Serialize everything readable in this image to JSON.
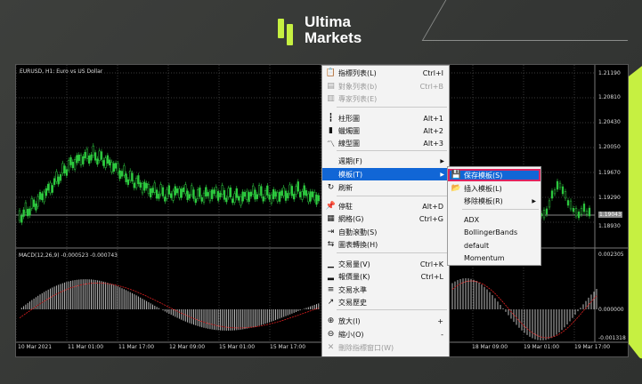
{
  "brand": {
    "line1": "Ultima",
    "line2": "Markets",
    "accent": "#c6f041"
  },
  "chart": {
    "symbol_label": "EURUSD, H1:  Euro vs US Dollar",
    "macd_label": "MACD(12,26,9) -0.000523 -0.000743",
    "y_ticks_main": [
      "1.21190",
      "1.20810",
      "1.20430",
      "1.20050",
      "1.19670",
      "1.19290",
      "1.18930"
    ],
    "current_price": "1.19043",
    "y_ticks_macd": [
      "0.002305",
      "0.000000",
      "-0.001318"
    ],
    "x_ticks": [
      "10 Mar 2021",
      "11 Mar 01:00",
      "11 Mar 17:00",
      "12 Mar 09:00",
      "15 Mar 01:00",
      "15 Mar 17:00",
      "",
      "",
      "",
      "18 Mar 09:00",
      "19 Mar 01:00",
      "19 Mar 17:00"
    ]
  },
  "context_menu": {
    "items": [
      {
        "label": "指標列表(L)",
        "shortcut": "Ctrl+I",
        "icon": "indicator-list-icon",
        "glyph": "📋",
        "disabled": false
      },
      {
        "label": "對象列表(b)",
        "shortcut": "Ctrl+B",
        "icon": "object-list-icon",
        "glyph": "▤",
        "disabled": true
      },
      {
        "label": "專家列表(E)",
        "shortcut": "",
        "icon": "expert-list-icon",
        "glyph": "▥",
        "disabled": true
      },
      {
        "label": "柱形圖",
        "shortcut": "Alt+1",
        "icon": "bar-chart-icon",
        "glyph": "┇",
        "disabled": false
      },
      {
        "label": "蠟燭圖",
        "shortcut": "Alt+2",
        "icon": "candlestick-icon",
        "glyph": "▮",
        "disabled": false
      },
      {
        "label": "線型圖",
        "shortcut": "Alt+3",
        "icon": "line-chart-icon",
        "glyph": "〽",
        "disabled": false
      },
      {
        "label": "週期(F)",
        "shortcut": "",
        "icon": "",
        "glyph": "",
        "disabled": false,
        "submenu": true
      },
      {
        "label": "模板(T)",
        "shortcut": "",
        "icon": "",
        "glyph": "",
        "disabled": false,
        "submenu": true,
        "selected": true
      },
      {
        "label": "刷新",
        "shortcut": "",
        "icon": "refresh-icon",
        "glyph": "↻",
        "disabled": false
      },
      {
        "label": "停駐",
        "shortcut": "Alt+D",
        "icon": "pin-icon",
        "glyph": "📌",
        "disabled": false
      },
      {
        "label": "網格(G)",
        "shortcut": "Ctrl+G",
        "icon": "grid-icon",
        "glyph": "▦",
        "disabled": false
      },
      {
        "label": "自動滾動(S)",
        "shortcut": "",
        "icon": "autoscroll-icon",
        "glyph": "⇥",
        "disabled": false
      },
      {
        "label": "圖表轉換(H)",
        "shortcut": "",
        "icon": "chart-shift-icon",
        "glyph": "⇆",
        "disabled": false
      },
      {
        "label": "交易量(V)",
        "shortcut": "Ctrl+K",
        "icon": "volume-icon",
        "glyph": "▁",
        "disabled": false
      },
      {
        "label": "報價量(K)",
        "shortcut": "Ctrl+L",
        "icon": "tick-volume-icon",
        "glyph": "▂",
        "disabled": false
      },
      {
        "label": "交易水準",
        "shortcut": "",
        "icon": "trade-levels-icon",
        "glyph": "≡",
        "disabled": false
      },
      {
        "label": "交易歷史",
        "shortcut": "",
        "icon": "trade-history-icon",
        "glyph": "↗",
        "disabled": false
      },
      {
        "label": "放大(I)",
        "shortcut": "+",
        "icon": "zoom-in-icon",
        "glyph": "⊕",
        "disabled": false
      },
      {
        "label": "縮小(O)",
        "shortcut": "-",
        "icon": "zoom-out-icon",
        "glyph": "⊖",
        "disabled": false
      },
      {
        "label": "刪除指標窗口(W)",
        "shortcut": "",
        "icon": "delete-window-icon",
        "glyph": "✕",
        "disabled": true
      }
    ]
  },
  "template_submenu": {
    "items": [
      {
        "label": "保存模板(S)",
        "icon": "save-template-icon",
        "glyph": "💾",
        "highlighted": true
      },
      {
        "label": "插入模板(L)",
        "icon": "load-template-icon",
        "glyph": "📂"
      },
      {
        "label": "移除模板(R)",
        "icon": "",
        "glyph": "",
        "submenu": true
      },
      {
        "label": "ADX",
        "icon": "",
        "glyph": ""
      },
      {
        "label": "BollingerBands",
        "icon": "",
        "glyph": ""
      },
      {
        "label": "default",
        "icon": "",
        "glyph": ""
      },
      {
        "label": "Momentum",
        "icon": "",
        "glyph": ""
      }
    ]
  }
}
